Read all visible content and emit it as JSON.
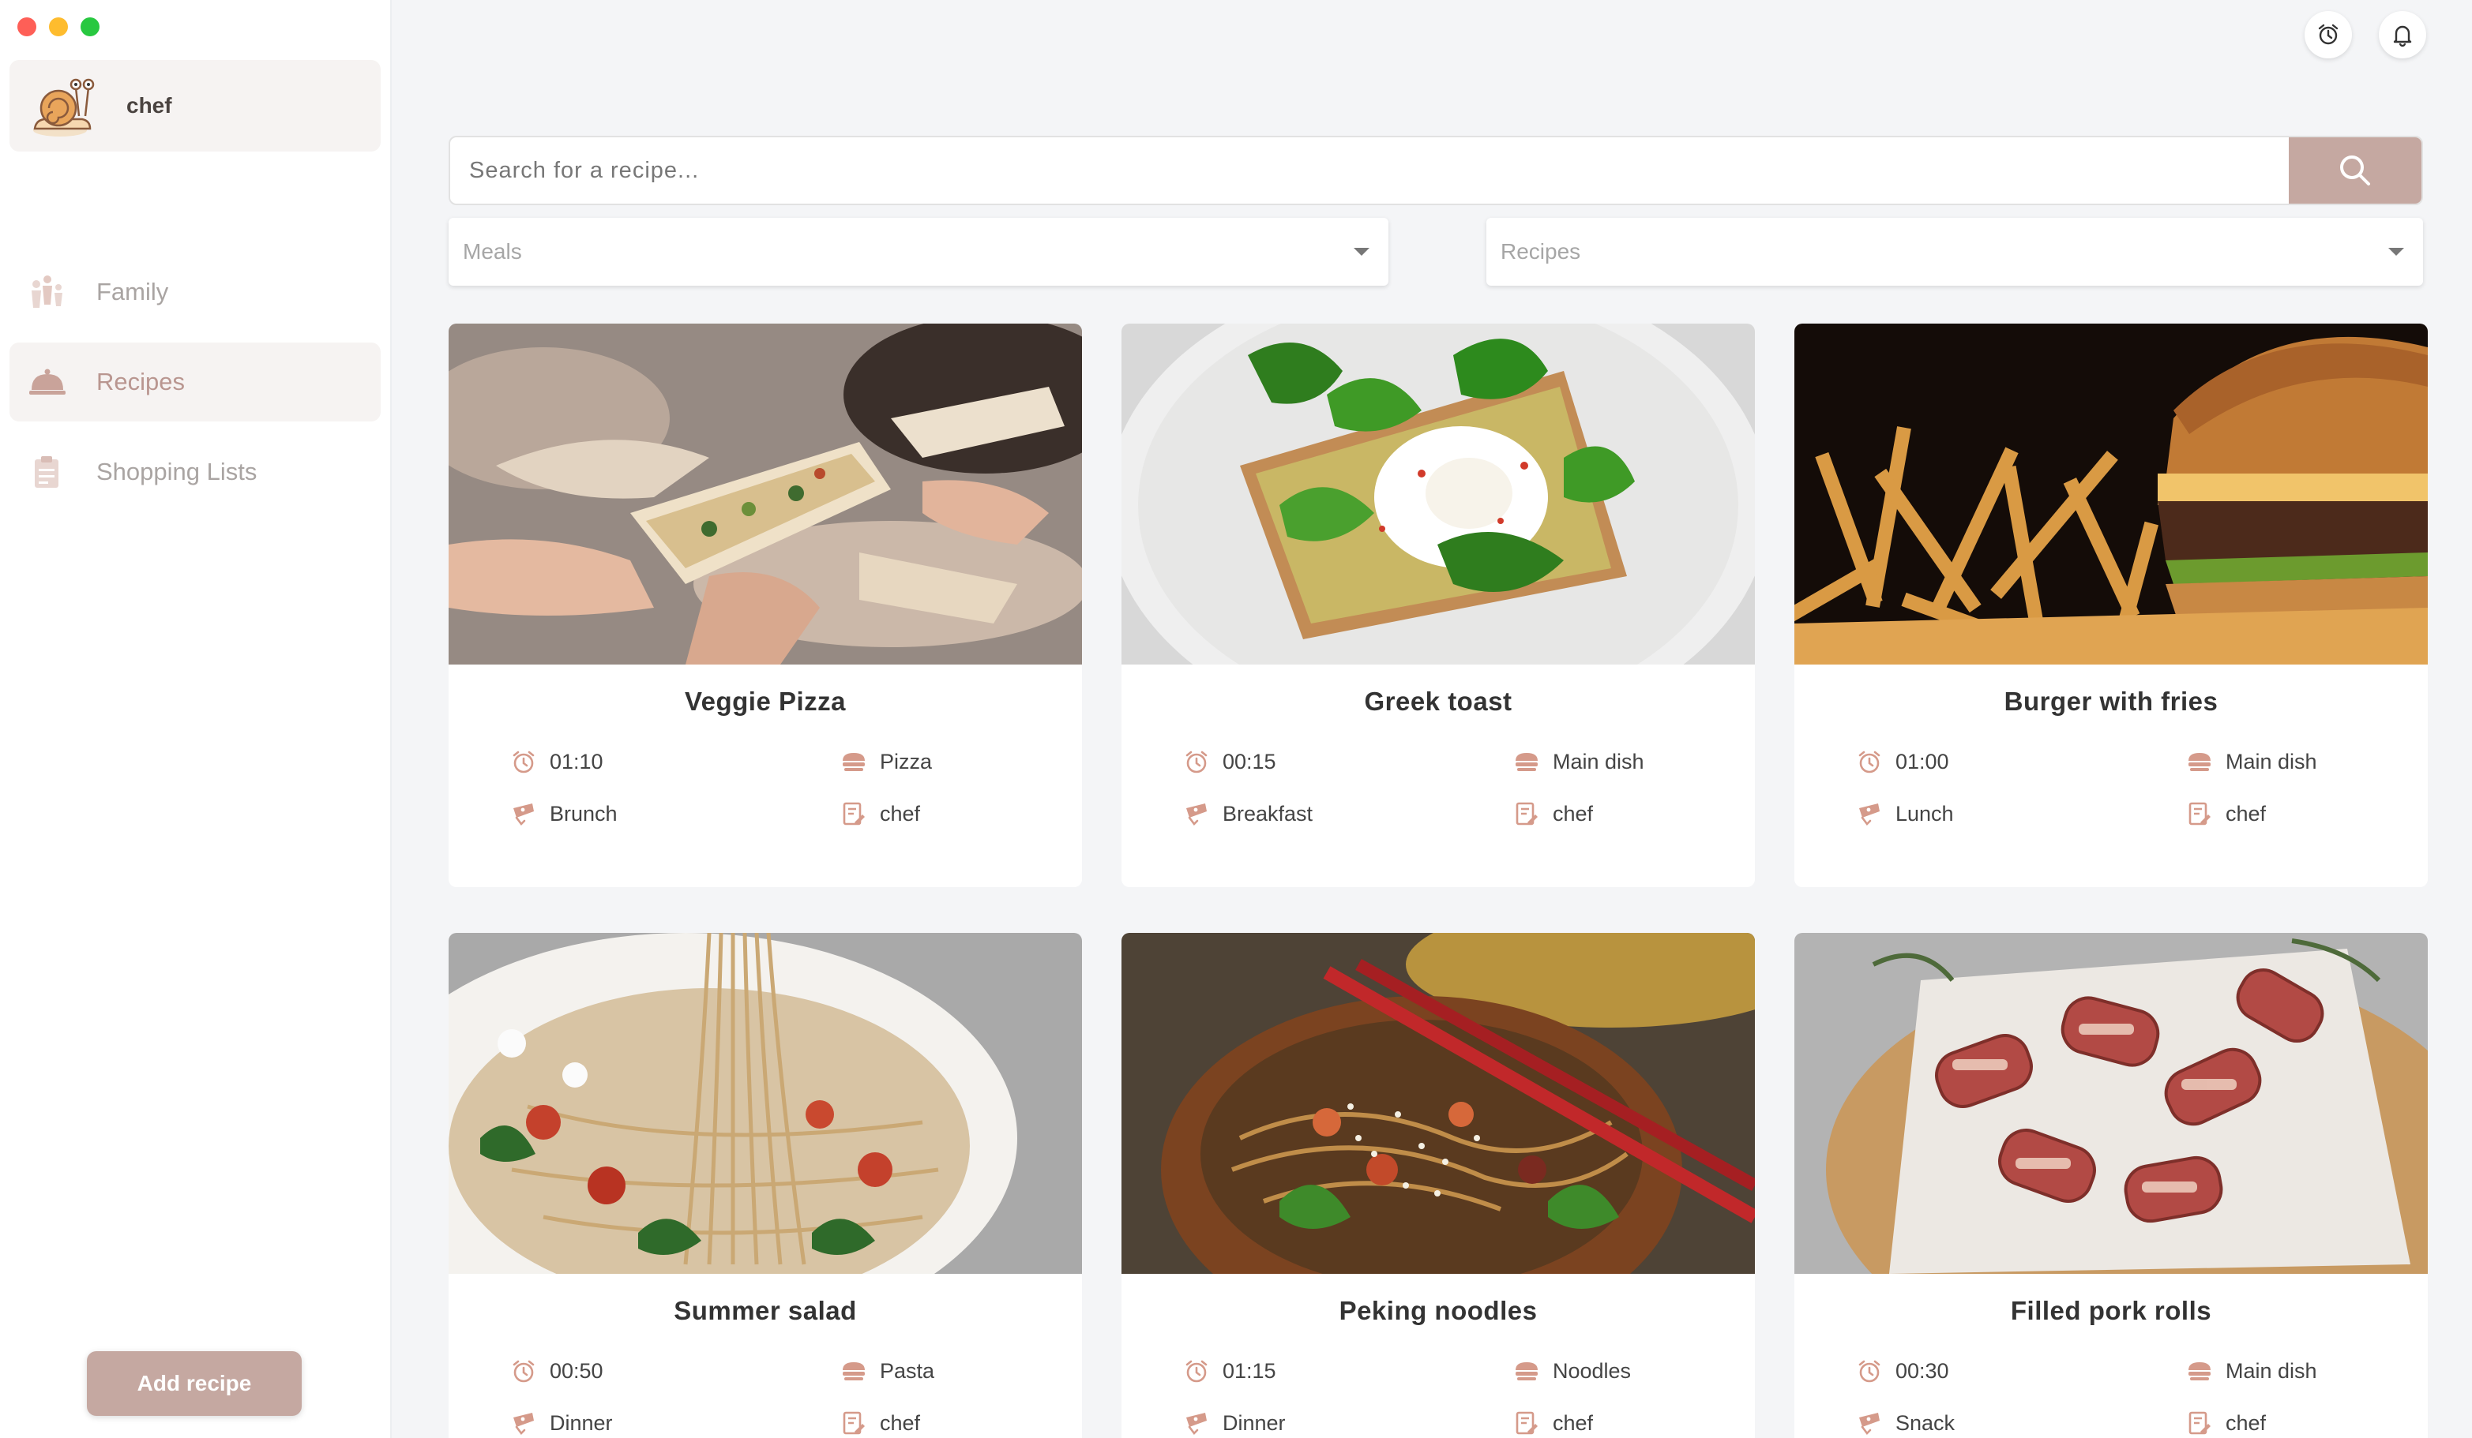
{
  "sidebar": {
    "profile_name": "chef",
    "items": [
      {
        "label": "Family",
        "icon": "family-icon"
      },
      {
        "label": "Recipes",
        "icon": "cloche-icon",
        "active": true
      },
      {
        "label": "Shopping Lists",
        "icon": "shopping-list-icon"
      }
    ],
    "add_recipe_label": "Add recipe"
  },
  "header": {
    "icons": [
      "alarm-icon",
      "bell-icon"
    ]
  },
  "search": {
    "placeholder": "Search for a recipe..."
  },
  "filters": {
    "meals_placeholder": "Meals",
    "recipes_placeholder": "Recipes"
  },
  "colors": {
    "accent": "#c5a8a1",
    "icon_tint": "#d59a8a",
    "active_text": "#b99690"
  },
  "recipes": [
    {
      "title": "Veggie Pizza",
      "time": "01:10",
      "category": "Pizza",
      "meal": "Brunch",
      "author": "chef"
    },
    {
      "title": "Greek toast",
      "time": "00:15",
      "category": "Main dish",
      "meal": "Breakfast",
      "author": "chef"
    },
    {
      "title": "Burger with fries",
      "time": "01:00",
      "category": "Main dish",
      "meal": "Lunch",
      "author": "chef"
    },
    {
      "title": "Summer salad",
      "time": "00:50",
      "category": "Pasta",
      "meal": "Dinner",
      "author": "chef"
    },
    {
      "title": "Peking noodles",
      "time": "01:15",
      "category": "Noodles",
      "meal": "Dinner",
      "author": "chef"
    },
    {
      "title": "Filled pork rolls",
      "time": "00:30",
      "category": "Main dish",
      "meal": "Snack",
      "author": "chef"
    }
  ]
}
